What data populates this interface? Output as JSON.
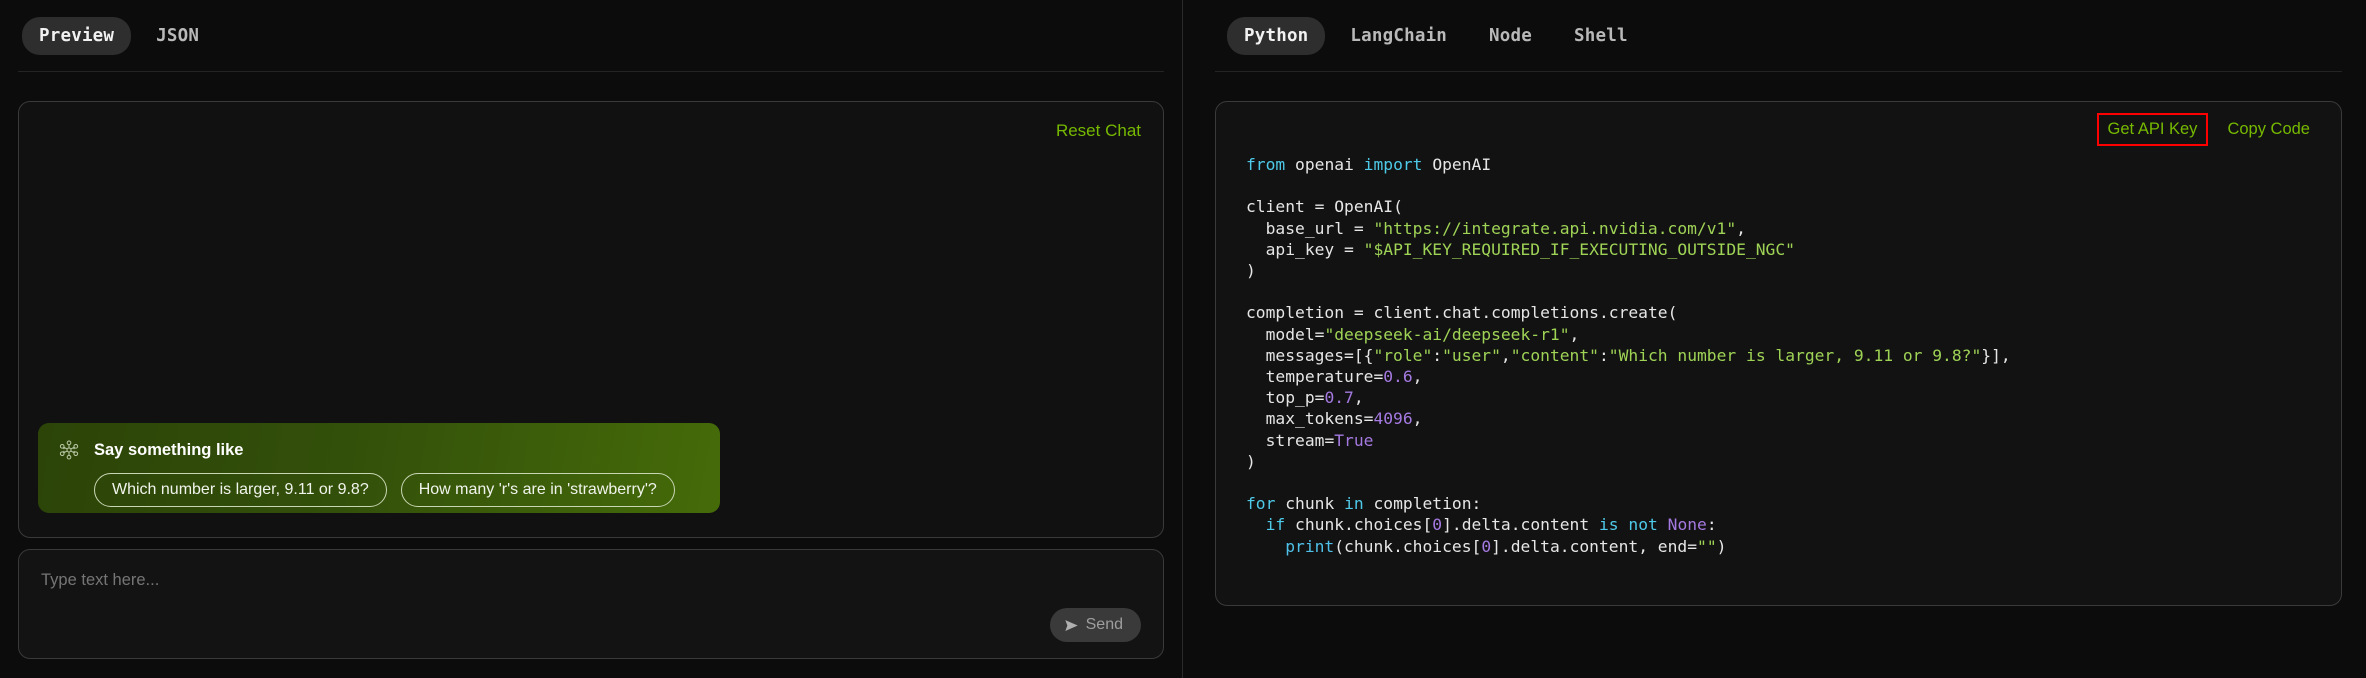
{
  "left_panel": {
    "tabs": [
      {
        "label": "Preview",
        "active": true
      },
      {
        "label": "JSON",
        "active": false
      }
    ],
    "chat": {
      "reset_label": "Reset Chat",
      "suggestion": {
        "icon": "molecule-icon",
        "title": "Say something like",
        "chips": [
          "Which number is larger, 9.11 or 9.8?",
          "How many 'r's are in 'strawberry'?"
        ]
      }
    },
    "composer": {
      "placeholder": "Type text here...",
      "send_label": "Send",
      "send_icon": "paper-plane-icon"
    }
  },
  "right_panel": {
    "tabs": [
      {
        "label": "Python",
        "active": true
      },
      {
        "label": "LangChain",
        "active": false
      },
      {
        "label": "Node",
        "active": false
      },
      {
        "label": "Shell",
        "active": false
      }
    ],
    "actions": {
      "get_api_key": "Get API Key",
      "copy_code": "Copy Code"
    },
    "code_lines": [
      "from openai import OpenAI",
      "",
      "client = OpenAI(",
      "  base_url = \"https://integrate.api.nvidia.com/v1\",",
      "  api_key = \"$API_KEY_REQUIRED_IF_EXECUTING_OUTSIDE_NGC\"",
      ")",
      "",
      "completion = client.chat.completions.create(",
      "  model=\"deepseek-ai/deepseek-r1\",",
      "  messages=[{\"role\":\"user\",\"content\":\"Which number is larger, 9.11 or 9.8?\"}],",
      "  temperature=0.6,",
      "  top_p=0.7,",
      "  max_tokens=4096,",
      "  stream=True",
      ")",
      "",
      "for chunk in completion:",
      "  if chunk.choices[0].delta.content is not None:",
      "    print(chunk.choices[0].delta.content, end=\"\")"
    ]
  },
  "colors": {
    "background": "#0c0c0c",
    "accent_green": "#76b900",
    "highlight_red": "#ff0000",
    "card_border": "#3a3a3a",
    "suggestion_gradient_start": "#2c4408",
    "suggestion_gradient_end": "#456b09",
    "code_string": "#9fd356",
    "code_keyword": "#4ec9e8",
    "code_number": "#a479e0"
  }
}
